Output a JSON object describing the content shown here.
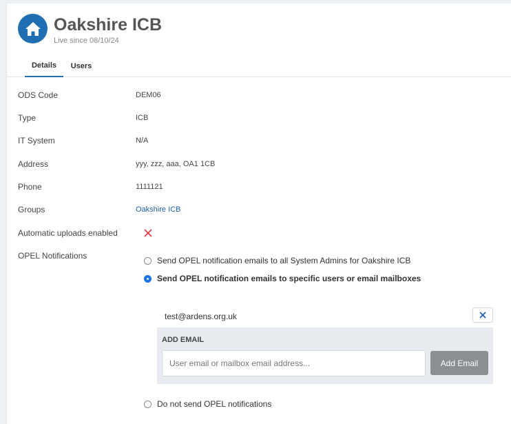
{
  "org": {
    "name": "Oakshire ICB",
    "subtitle": "Live since 08/10/24",
    "icon": "house-icon",
    "accent": "#1f6fb2"
  },
  "tabs": [
    {
      "label": "Details",
      "active": true
    },
    {
      "label": "Users",
      "active": false
    }
  ],
  "details": {
    "ods_code": {
      "label": "ODS Code",
      "value": "DEM06"
    },
    "type": {
      "label": "Type",
      "value": "ICB"
    },
    "it_system": {
      "label": "IT System",
      "value": "N/A"
    },
    "address": {
      "label": "Address",
      "value": "yyy, zzz, aaa, OA1 1CB"
    },
    "phone": {
      "label": "Phone",
      "value": "1111121"
    },
    "groups": {
      "label": "Groups",
      "value": "Oakshire ICB"
    },
    "auto_uploads": {
      "label": "Automatic uploads enabled",
      "icon": "cross-icon",
      "enabled": false
    },
    "opel": {
      "label": "OPEL Notifications"
    }
  },
  "opel_options": [
    {
      "label": "Send OPEL notification emails to all System Admins for Oakshire ICB",
      "checked": false
    },
    {
      "label": "Send OPEL notification emails to specific users or email mailboxes",
      "checked": true
    },
    {
      "label": "Do not send OPEL notifications",
      "checked": false
    }
  ],
  "emails": [
    "test@ardens.org.uk"
  ],
  "add_email": {
    "title": "ADD EMAIL",
    "placeholder": "User email or mailbox email address...",
    "button": "Add Email"
  }
}
